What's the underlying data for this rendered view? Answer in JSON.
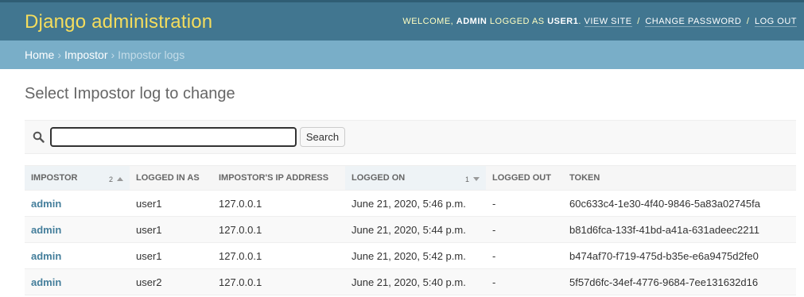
{
  "header": {
    "brand": "Django administration",
    "welcome": "Welcome,",
    "username": "admin",
    "logged_as": "Logged as",
    "impersonated": "user1",
    "view_site": "View site",
    "change_password": "Change password",
    "log_out": "Log out",
    "period": ".",
    "separator": "/"
  },
  "breadcrumbs": {
    "home": "Home",
    "app": "Impostor",
    "current": "Impostor logs",
    "separator": "›"
  },
  "page": {
    "title": "Select Impostor log to change"
  },
  "search": {
    "value": "",
    "button_label": "Search",
    "icon": "search-icon"
  },
  "table": {
    "columns": [
      {
        "label": "Impostor",
        "sort_priority": "2",
        "sort_direction": "ascending"
      },
      {
        "label": "Logged in as"
      },
      {
        "label": "Impostor's IP address"
      },
      {
        "label": "Logged on",
        "sort_priority": "1",
        "sort_direction": "descending"
      },
      {
        "label": "Logged out"
      },
      {
        "label": "Token"
      }
    ],
    "rows": [
      {
        "impostor": "admin",
        "logged_in_as": "user1",
        "ip": "127.0.0.1",
        "logged_on": "June 21, 2020, 5:46 p.m.",
        "logged_out": "-",
        "token": "60c633c4-1e30-4f40-9846-5a83a02745fa"
      },
      {
        "impostor": "admin",
        "logged_in_as": "user1",
        "ip": "127.0.0.1",
        "logged_on": "June 21, 2020, 5:44 p.m.",
        "logged_out": "-",
        "token": "b81d6fca-133f-41bd-a41a-631adeec2211"
      },
      {
        "impostor": "admin",
        "logged_in_as": "user1",
        "ip": "127.0.0.1",
        "logged_on": "June 21, 2020, 5:42 p.m.",
        "logged_out": "-",
        "token": "b474af70-f719-475d-b35e-e6a9475d2fe0"
      },
      {
        "impostor": "admin",
        "logged_in_as": "user2",
        "ip": "127.0.0.1",
        "logged_on": "June 21, 2020, 5:40 p.m.",
        "logged_out": "-",
        "token": "5f57d6fc-34ef-4776-9684-7ee131632d16"
      }
    ]
  },
  "colors": {
    "header_bg": "#417690",
    "brand": "#f5dd5d",
    "breadcrumbs_bg": "#79aec8",
    "link": "#447e9b"
  }
}
